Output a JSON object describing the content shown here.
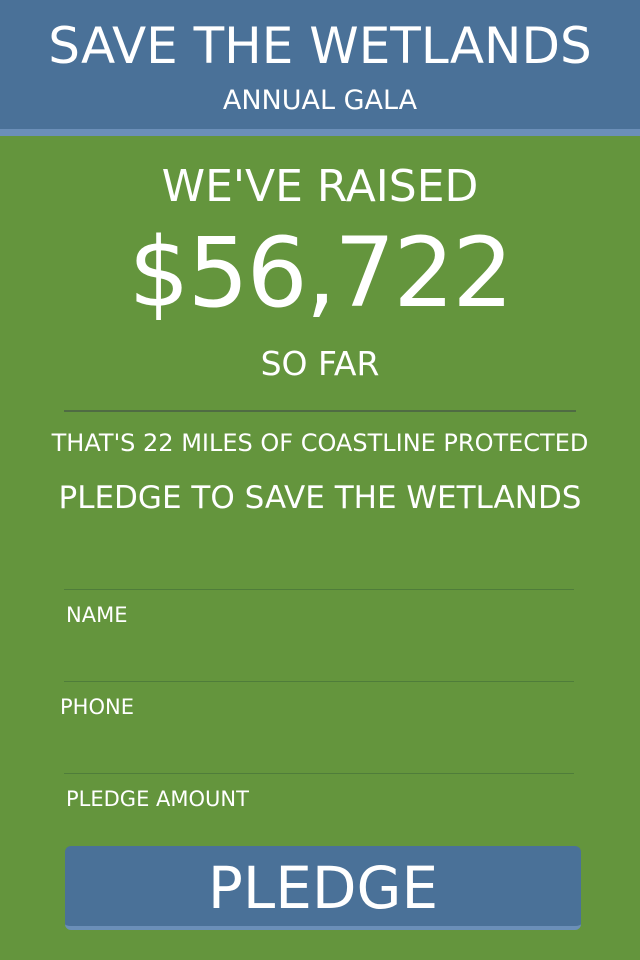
{
  "header": {
    "title": "SAVE THE WETLANDS",
    "subtitle": "ANNUAL GALA"
  },
  "fundraiser": {
    "raised_label": "WE'VE RAISED",
    "raised_amount": "$56,722",
    "raised_suffix": "SO FAR",
    "impact_text": "THAT'S 22 MILES OF COASTLINE PROTECTED",
    "cta_text": "PLEDGE TO SAVE THE WETLANDS"
  },
  "form": {
    "name_placeholder": "NAME",
    "phone_placeholder": "PHONE",
    "pledge_amount_placeholder": "PLEDGE AMOUNT",
    "submit_label": "PLEDGE"
  },
  "colors": {
    "background": "#64953d",
    "header": "#4a7198",
    "accent": "#6b8fb8",
    "text": "#ffffff"
  }
}
